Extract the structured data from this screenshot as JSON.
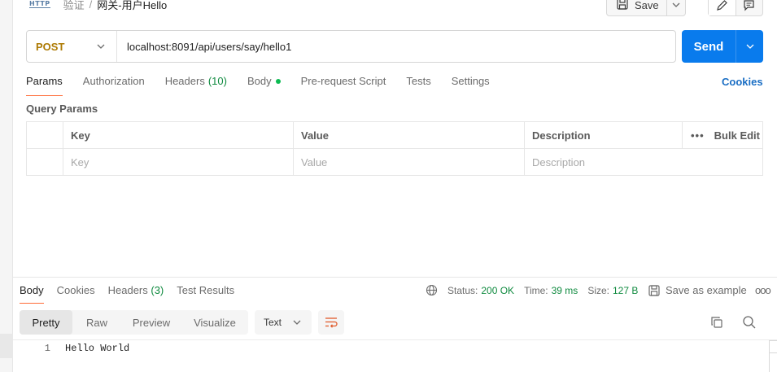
{
  "breadcrumb": {
    "protocol_badge": "HTTP",
    "parent": "验证",
    "separator": "/",
    "current": "网关-用户Hello"
  },
  "toolbar": {
    "save_label": "Save"
  },
  "request": {
    "method": "POST",
    "url": "localhost:8091/api/users/say/hello1",
    "send_label": "Send",
    "method_color": "#ad7a03",
    "send_color": "#097bed"
  },
  "request_tabs": [
    {
      "label": "Params",
      "active": true
    },
    {
      "label": "Authorization"
    },
    {
      "label": "Headers",
      "count": "(10)"
    },
    {
      "label": "Body",
      "dot": true
    },
    {
      "label": "Pre-request Script"
    },
    {
      "label": "Tests"
    },
    {
      "label": "Settings"
    }
  ],
  "cookies_link": "Cookies",
  "query_params": {
    "title": "Query Params",
    "columns": {
      "key": "Key",
      "value": "Value",
      "description": "Description"
    },
    "bulk_edit": "Bulk Edit",
    "placeholders": {
      "key": "Key",
      "value": "Value",
      "description": "Description"
    }
  },
  "response": {
    "tabs": [
      {
        "label": "Body",
        "active": true
      },
      {
        "label": "Cookies"
      },
      {
        "label": "Headers",
        "count": "(3)"
      },
      {
        "label": "Test Results"
      }
    ],
    "status_label": "Status:",
    "status_value": "200 OK",
    "time_label": "Time:",
    "time_value": "39 ms",
    "size_label": "Size:",
    "size_value": "127 B",
    "save_example": "Save as example",
    "views": [
      "Pretty",
      "Raw",
      "Preview",
      "Visualize"
    ],
    "format": "Text",
    "lines": [
      {
        "no": "1",
        "text": "Hello World"
      }
    ],
    "accent_color": "#ff6c37",
    "success_color": "#0f8a3f"
  }
}
